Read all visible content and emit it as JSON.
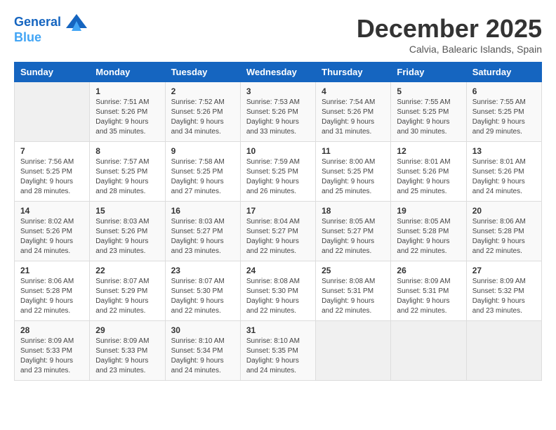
{
  "logo": {
    "line1": "General",
    "line2": "Blue"
  },
  "title": "December 2025",
  "location": "Calvia, Balearic Islands, Spain",
  "days_of_week": [
    "Sunday",
    "Monday",
    "Tuesday",
    "Wednesday",
    "Thursday",
    "Friday",
    "Saturday"
  ],
  "weeks": [
    [
      {
        "day": "",
        "info": ""
      },
      {
        "day": "1",
        "info": "Sunrise: 7:51 AM\nSunset: 5:26 PM\nDaylight: 9 hours\nand 35 minutes."
      },
      {
        "day": "2",
        "info": "Sunrise: 7:52 AM\nSunset: 5:26 PM\nDaylight: 9 hours\nand 34 minutes."
      },
      {
        "day": "3",
        "info": "Sunrise: 7:53 AM\nSunset: 5:26 PM\nDaylight: 9 hours\nand 33 minutes."
      },
      {
        "day": "4",
        "info": "Sunrise: 7:54 AM\nSunset: 5:26 PM\nDaylight: 9 hours\nand 31 minutes."
      },
      {
        "day": "5",
        "info": "Sunrise: 7:55 AM\nSunset: 5:25 PM\nDaylight: 9 hours\nand 30 minutes."
      },
      {
        "day": "6",
        "info": "Sunrise: 7:55 AM\nSunset: 5:25 PM\nDaylight: 9 hours\nand 29 minutes."
      }
    ],
    [
      {
        "day": "7",
        "info": "Sunrise: 7:56 AM\nSunset: 5:25 PM\nDaylight: 9 hours\nand 28 minutes."
      },
      {
        "day": "8",
        "info": "Sunrise: 7:57 AM\nSunset: 5:25 PM\nDaylight: 9 hours\nand 28 minutes."
      },
      {
        "day": "9",
        "info": "Sunrise: 7:58 AM\nSunset: 5:25 PM\nDaylight: 9 hours\nand 27 minutes."
      },
      {
        "day": "10",
        "info": "Sunrise: 7:59 AM\nSunset: 5:25 PM\nDaylight: 9 hours\nand 26 minutes."
      },
      {
        "day": "11",
        "info": "Sunrise: 8:00 AM\nSunset: 5:25 PM\nDaylight: 9 hours\nand 25 minutes."
      },
      {
        "day": "12",
        "info": "Sunrise: 8:01 AM\nSunset: 5:26 PM\nDaylight: 9 hours\nand 25 minutes."
      },
      {
        "day": "13",
        "info": "Sunrise: 8:01 AM\nSunset: 5:26 PM\nDaylight: 9 hours\nand 24 minutes."
      }
    ],
    [
      {
        "day": "14",
        "info": "Sunrise: 8:02 AM\nSunset: 5:26 PM\nDaylight: 9 hours\nand 24 minutes."
      },
      {
        "day": "15",
        "info": "Sunrise: 8:03 AM\nSunset: 5:26 PM\nDaylight: 9 hours\nand 23 minutes."
      },
      {
        "day": "16",
        "info": "Sunrise: 8:03 AM\nSunset: 5:27 PM\nDaylight: 9 hours\nand 23 minutes."
      },
      {
        "day": "17",
        "info": "Sunrise: 8:04 AM\nSunset: 5:27 PM\nDaylight: 9 hours\nand 22 minutes."
      },
      {
        "day": "18",
        "info": "Sunrise: 8:05 AM\nSunset: 5:27 PM\nDaylight: 9 hours\nand 22 minutes."
      },
      {
        "day": "19",
        "info": "Sunrise: 8:05 AM\nSunset: 5:28 PM\nDaylight: 9 hours\nand 22 minutes."
      },
      {
        "day": "20",
        "info": "Sunrise: 8:06 AM\nSunset: 5:28 PM\nDaylight: 9 hours\nand 22 minutes."
      }
    ],
    [
      {
        "day": "21",
        "info": "Sunrise: 8:06 AM\nSunset: 5:28 PM\nDaylight: 9 hours\nand 22 minutes."
      },
      {
        "day": "22",
        "info": "Sunrise: 8:07 AM\nSunset: 5:29 PM\nDaylight: 9 hours\nand 22 minutes."
      },
      {
        "day": "23",
        "info": "Sunrise: 8:07 AM\nSunset: 5:30 PM\nDaylight: 9 hours\nand 22 minutes."
      },
      {
        "day": "24",
        "info": "Sunrise: 8:08 AM\nSunset: 5:30 PM\nDaylight: 9 hours\nand 22 minutes."
      },
      {
        "day": "25",
        "info": "Sunrise: 8:08 AM\nSunset: 5:31 PM\nDaylight: 9 hours\nand 22 minutes."
      },
      {
        "day": "26",
        "info": "Sunrise: 8:09 AM\nSunset: 5:31 PM\nDaylight: 9 hours\nand 22 minutes."
      },
      {
        "day": "27",
        "info": "Sunrise: 8:09 AM\nSunset: 5:32 PM\nDaylight: 9 hours\nand 23 minutes."
      }
    ],
    [
      {
        "day": "28",
        "info": "Sunrise: 8:09 AM\nSunset: 5:33 PM\nDaylight: 9 hours\nand 23 minutes."
      },
      {
        "day": "29",
        "info": "Sunrise: 8:09 AM\nSunset: 5:33 PM\nDaylight: 9 hours\nand 23 minutes."
      },
      {
        "day": "30",
        "info": "Sunrise: 8:10 AM\nSunset: 5:34 PM\nDaylight: 9 hours\nand 24 minutes."
      },
      {
        "day": "31",
        "info": "Sunrise: 8:10 AM\nSunset: 5:35 PM\nDaylight: 9 hours\nand 24 minutes."
      },
      {
        "day": "",
        "info": ""
      },
      {
        "day": "",
        "info": ""
      },
      {
        "day": "",
        "info": ""
      }
    ]
  ]
}
